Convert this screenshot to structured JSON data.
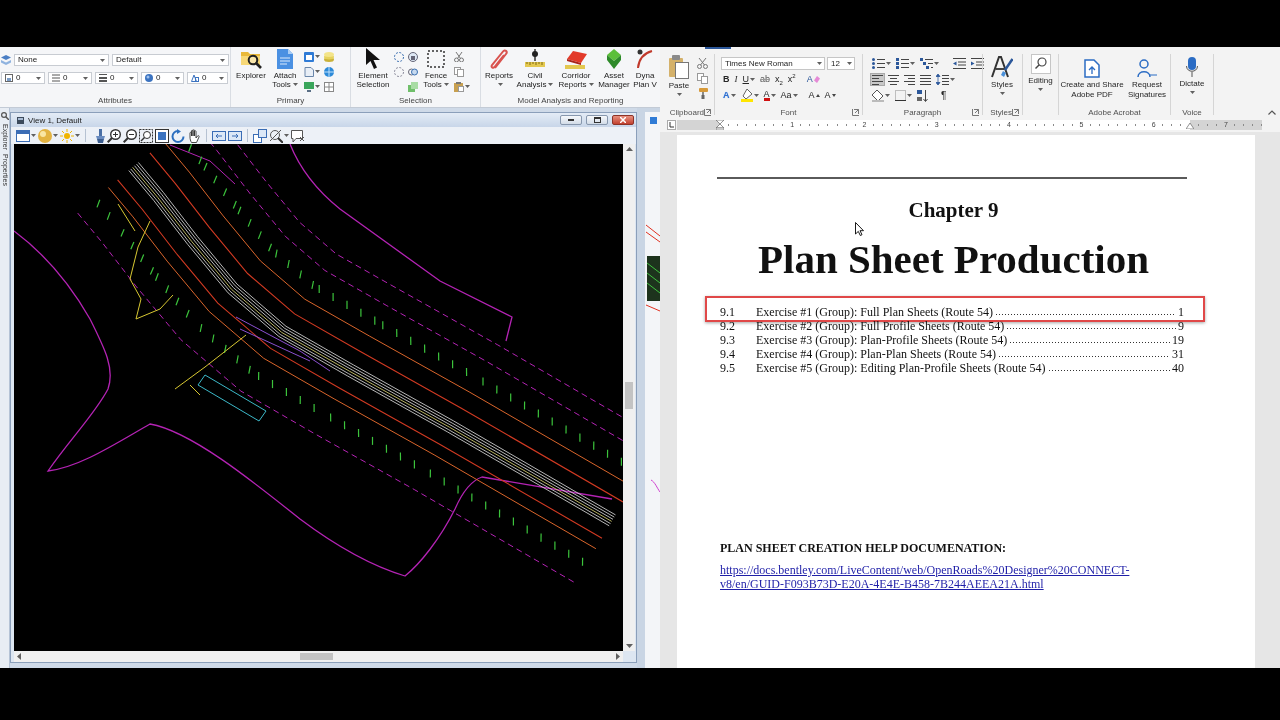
{
  "cad_app": {
    "ribbon": {
      "attributes": {
        "label": "Attributes",
        "dropdowns": [
          {
            "value": "None"
          },
          {
            "value": "Default"
          }
        ],
        "small_dropdowns": [
          {
            "value": "0"
          },
          {
            "value": "0"
          },
          {
            "value": "0"
          },
          {
            "value": "0"
          },
          {
            "value": "0"
          }
        ]
      },
      "primary": {
        "label": "Primary",
        "buttons": [
          {
            "label": "Explorer",
            "dropdown": false
          },
          {
            "label": "Attach Tools",
            "dropdown": true
          }
        ]
      },
      "selection": {
        "label": "Selection",
        "buttons": [
          {
            "label": "Element Selection",
            "dropdown": false
          },
          {
            "label": "Fence Tools",
            "dropdown": true
          }
        ]
      },
      "analysis": {
        "label": "Model Analysis and Reporting",
        "buttons": [
          {
            "label": "Reports",
            "dropdown": true
          },
          {
            "label": "Civil Analysis",
            "dropdown": true
          },
          {
            "label": "Corridor Reports",
            "dropdown": true
          },
          {
            "label": "Asset Manager",
            "dropdown": false
          },
          {
            "label": "Dyna Plan V",
            "dropdown": false
          }
        ]
      }
    },
    "side_tabs": [
      {
        "label": "Explorer"
      },
      {
        "label": "Properties"
      }
    ],
    "view": {
      "title": "View 1, Default"
    }
  },
  "word_app": {
    "ribbon": {
      "clipboard": {
        "label": "Clipboard",
        "paste": "Paste"
      },
      "font": {
        "label": "Font",
        "font_name": "Times New Roman",
        "font_size": "12",
        "format_buttons": [
          {
            "kind": "bold",
            "label": "B",
            "dropdown": false
          },
          {
            "kind": "italic",
            "label": "I",
            "dropdown": false
          },
          {
            "kind": "underline",
            "label": "U",
            "dropdown": true
          },
          {
            "kind": "strikethrough",
            "label": "ab",
            "dropdown": false
          },
          {
            "kind": "subscript",
            "label": "x$_{2}$",
            "dropdown": false
          },
          {
            "kind": "superscript",
            "label": "x$^{2}$",
            "dropdown": false
          },
          {
            "kind": "clear",
            "label": "A",
            "dropdown": false
          }
        ],
        "effect_buttons": [
          {
            "kind": "effects",
            "label": "A",
            "dropdown": true
          },
          {
            "kind": "highlight",
            "dropdown": true
          },
          {
            "kind": "color",
            "label": "A",
            "dropdown": true
          },
          {
            "kind": "case",
            "label": "Aa",
            "dropdown": true
          },
          {
            "kind": "grow",
            "label": "A",
            "dropdown": false
          },
          {
            "kind": "shrink",
            "label": "A",
            "dropdown": false
          }
        ]
      },
      "paragraph": {
        "label": "Paragraph",
        "align_buttons": [
          {
            "selected": true
          },
          {
            "selected": false
          },
          {
            "selected": false
          },
          {
            "selected": false
          }
        ],
        "marks_button": "¶"
      },
      "styles": {
        "label": "Styles",
        "button": "Styles"
      },
      "editing": {
        "button": "Editing"
      },
      "adobe_acrobat": {
        "label": "Adobe Acrobat",
        "buttons": [
          "Create and Share Adobe PDF",
          "Request Signatures"
        ]
      },
      "voice": {
        "label": "Voice",
        "button": "Dictate"
      }
    },
    "ruler": {
      "numbers": [
        "1",
        "2",
        "3",
        "4",
        "5",
        "6",
        "7"
      ]
    },
    "document": {
      "chapter": "Chapter 9",
      "title": "Plan Sheet Production",
      "toc": [
        {
          "number": "9.1",
          "title": "Exercise #1 (Group): Full Plan Sheets (Route 54)",
          "page": "1",
          "highlighted": true
        },
        {
          "number": "9.2",
          "title": "Exercise #2 (Group): Full Profile Sheets (Route 54)",
          "page": "9",
          "highlighted": false
        },
        {
          "number": "9.3",
          "title": "Exercise #3 (Group): Plan-Profile Sheets (Route 54)",
          "page": "19",
          "highlighted": false
        },
        {
          "number": "9.4",
          "title": "Exercise #4 (Group): Plan-Plan Sheets (Route 54)",
          "page": "31",
          "highlighted": false
        },
        {
          "number": "9.5",
          "title": "Exercise #5 (Group): Editing Plan-Profile Sheets (Route 54)",
          "page": "40",
          "highlighted": false
        }
      ],
      "help_heading": "PLAN SHEET CREATION HELP DOCUMENATION:",
      "help_link": "https://docs.bentley.com/LiveContent/web/OpenRoads%20Designer%20CONNECT-v8/en/GUID-F093B73D-E20A-4E4E-B458-7B244AEEA21A.html"
    }
  }
}
